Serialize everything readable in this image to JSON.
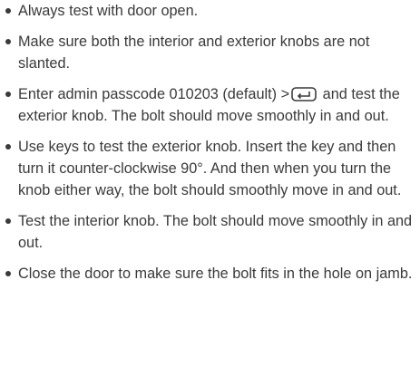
{
  "instructions": [
    {
      "text": "Always test with door open."
    },
    {
      "text": "Make sure both the interior and exterior knobs are not slanted."
    },
    {
      "text_before": "Enter admin passcode 010203 (default) >",
      "icon": "enter-key-icon",
      "text_after": "and test the exterior knob. The bolt should move smoothly in and out."
    },
    {
      "text": "Use keys to test the exterior knob. Insert the key and then turn it counter-clockwise 90°. And then when you turn the knob either way, the bolt should smoothly move in and out."
    },
    {
      "text": "Test the interior knob. The bolt should move smoothly in and out."
    },
    {
      "text": "Close the door to make sure the bolt fits in the hole on jamb."
    }
  ],
  "colors": {
    "text": "#3a3a3a",
    "background": "#ffffff"
  }
}
